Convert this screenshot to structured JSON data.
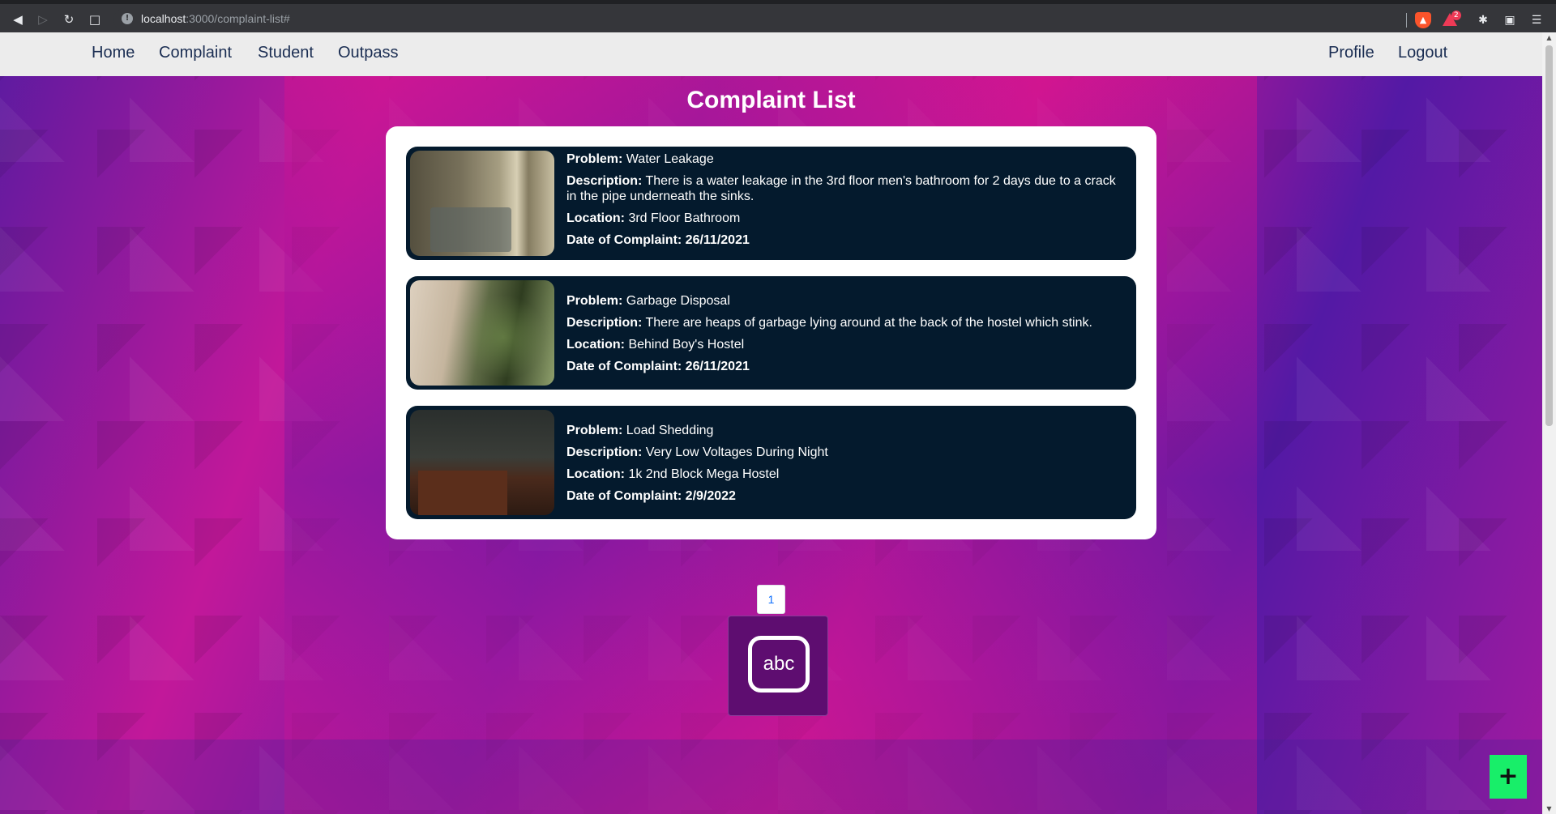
{
  "browser": {
    "url_host": "localhost",
    "url_path": ":3000/complaint-list#",
    "back_icon": "back-arrow-icon",
    "forward_icon": "forward-arrow-icon",
    "reload_icon": "reload-icon",
    "bookmark_icon": "bookmark-icon",
    "rewards_badge": "2"
  },
  "nav": {
    "left": [
      "Home",
      "Complaint",
      "Student",
      "Outpass"
    ],
    "right": [
      "Profile",
      "Logout"
    ]
  },
  "page": {
    "title": "Complaint List"
  },
  "labels": {
    "problem": "Problem:",
    "description": "Description:",
    "location": "Location:",
    "date": "Date of Complaint:"
  },
  "complaints": [
    {
      "problem": "Water Leakage",
      "description": "There is a water leakage in the 3rd floor men's bathroom for 2 days due to a crack in the pipe underneath the sinks.",
      "location": "3rd Floor Bathroom",
      "date": "26/11/2021"
    },
    {
      "problem": "Garbage Disposal",
      "description": "There are heaps of garbage lying around at the back of the hostel which stink.",
      "location": "Behind Boy's Hostel",
      "date": "26/11/2021"
    },
    {
      "problem": "Load Shedding",
      "description": "Very Low Voltages During Night",
      "location": "1k 2nd Block Mega Hostel",
      "date": "2/9/2022"
    }
  ],
  "pagination": {
    "current": "1"
  },
  "widget": {
    "text": "abc"
  },
  "fab": {
    "label": "+"
  },
  "colors": {
    "card_bg": "#041a2d",
    "fab": "#18ee69",
    "nav_text": "#1a2d52"
  }
}
